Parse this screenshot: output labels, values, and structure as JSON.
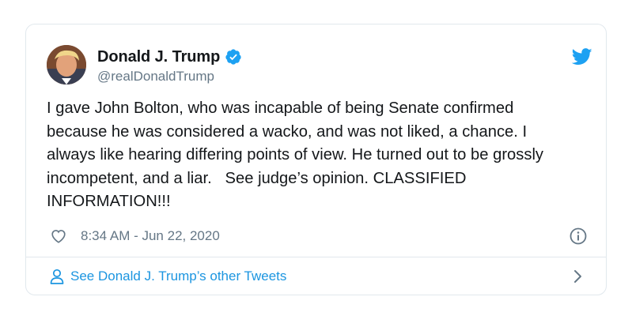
{
  "tweet": {
    "author": {
      "display_name": "Donald J. Trump",
      "handle": "@realDonaldTrump",
      "verified": true,
      "avatar_icon": "avatar-portrait"
    },
    "text": "I gave John Bolton, who was incapable of being Senate confirmed\nbecause he was considered a wacko, and was not liked, a chance. I\nalways like hearing differing points of view. He turned out to be grossly\nincompetent, and a liar.   See judge’s opinion. CLASSIFIED\nINFORMATION!!!",
    "timestamp": "8:34 AM - Jun 22, 2020",
    "icons": {
      "brand": "twitter-bird-icon",
      "like": "heart-icon",
      "info": "info-icon",
      "verified": "verified-badge-icon",
      "person": "person-icon",
      "chevron": "chevron-right-icon"
    }
  },
  "footer": {
    "link_label": "See Donald J. Trump’s other Tweets"
  },
  "colors": {
    "brand_blue": "#1da1f2",
    "link_blue": "#1b95e0",
    "secondary_text": "#657786",
    "border": "#e1e8ed"
  }
}
